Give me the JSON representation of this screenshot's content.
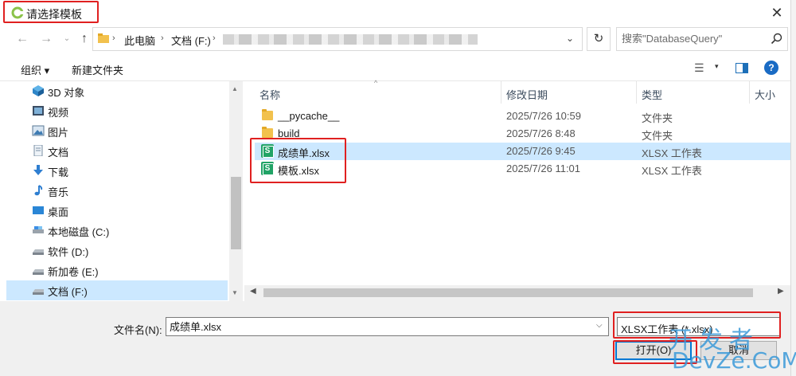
{
  "window": {
    "title": "请选择模板",
    "close_glyph": "✕"
  },
  "address": {
    "back_glyph": "←",
    "forward_glyph": "→",
    "recent_glyph": "⌄",
    "up_glyph": "↑",
    "separator_glyph": "›",
    "segments": [
      "此电脑",
      "文档 (F:)"
    ],
    "blurred_path": true,
    "dropdown_glyph": "⌄",
    "refresh_glyph": "↻"
  },
  "search": {
    "placeholder": "搜索\"DatabaseQuery\"",
    "icon": "search-icon"
  },
  "toolbar": {
    "organize_label": "组织 ▾",
    "new_folder_label": "新建文件夹",
    "view_glyph": "☰",
    "view_menu_glyph": "▾",
    "help_glyph": "?"
  },
  "nav": {
    "items": [
      {
        "label": "3D 对象",
        "icon": "3d-objects-icon"
      },
      {
        "label": "视频",
        "icon": "video-icon"
      },
      {
        "label": "图片",
        "icon": "pictures-icon"
      },
      {
        "label": "文档",
        "icon": "documents-icon"
      },
      {
        "label": "下载",
        "icon": "download-icon"
      },
      {
        "label": "音乐",
        "icon": "music-icon"
      },
      {
        "label": "桌面",
        "icon": "desktop-icon"
      },
      {
        "label": "本地磁盘 (C:)",
        "icon": "drive-icon"
      },
      {
        "label": "软件 (D:)",
        "icon": "drive-icon"
      },
      {
        "label": "新加卷 (E:)",
        "icon": "drive-icon"
      },
      {
        "label": "文档 (F:)",
        "icon": "drive-icon",
        "selected": true
      }
    ]
  },
  "files": {
    "columns": {
      "name": "名称",
      "date": "修改日期",
      "type": "类型",
      "size": "大小"
    },
    "rows": [
      {
        "name": "__pycache__",
        "date": "2025/7/26 10:59",
        "type": "文件夹",
        "kind": "folder"
      },
      {
        "name": "build",
        "date": "2025/7/26 8:48",
        "type": "文件夹",
        "kind": "folder"
      },
      {
        "name": "成绩单.xlsx",
        "date": "2025/7/26 9:45",
        "type": "XLSX 工作表",
        "kind": "xlsx",
        "selected": true
      },
      {
        "name": "模板.xlsx",
        "date": "2025/7/26 11:01",
        "type": "XLSX 工作表",
        "kind": "xlsx"
      }
    ]
  },
  "bottom": {
    "filename_label": "文件名(N):",
    "filename_value": "成绩单.xlsx",
    "filetype_value": "XLSX工作表 (*.xlsx)",
    "open_label": "打开(O)",
    "cancel_label": "取消"
  },
  "watermark": {
    "line1": "开发者",
    "line2": "DevZe.CoM"
  },
  "colors": {
    "selection": "#cce8ff",
    "accent": "#0078d4",
    "annotation": "#e02020",
    "excel_green": "#21a366",
    "folder_yellow": "#f2c14d"
  }
}
